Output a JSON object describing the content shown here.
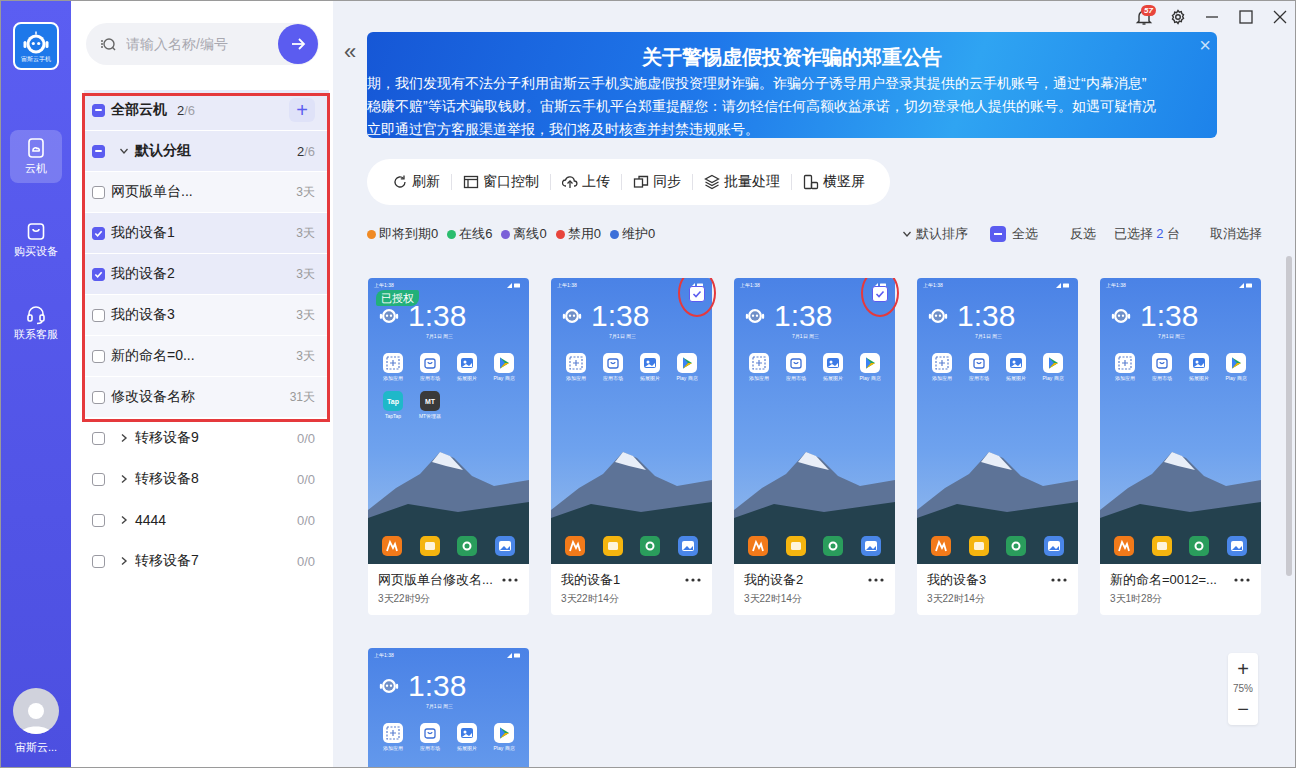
{
  "window": {
    "notification_count": "57"
  },
  "app": {
    "logo_text": "宙斯云手机"
  },
  "nav": [
    {
      "label": "云机",
      "selected": true,
      "kind": "phone"
    },
    {
      "label": "购买设备",
      "selected": false,
      "kind": "bag"
    },
    {
      "label": "联系客服",
      "selected": false,
      "kind": "headset"
    }
  ],
  "user": {
    "name": "宙斯云..."
  },
  "search": {
    "placeholder": "请输入名称/编号"
  },
  "collapse_button": "«",
  "tree": [
    {
      "kind": "all",
      "label": "全部云机",
      "count": "2",
      "total": "/6",
      "checked": false,
      "partial": true,
      "add": "+"
    },
    {
      "kind": "group",
      "label": "默认分组",
      "count": "2",
      "total": "/6",
      "checked": false,
      "partial": true,
      "expanded": true
    },
    {
      "kind": "device",
      "label": "网页版单台...",
      "days": "3天",
      "checked": false
    },
    {
      "kind": "device",
      "label": "我的设备1",
      "days": "3天",
      "checked": true
    },
    {
      "kind": "device",
      "label": "我的设备2",
      "days": "3天",
      "checked": true
    },
    {
      "kind": "device",
      "label": "我的设备3",
      "days": "3天",
      "checked": false
    },
    {
      "kind": "device",
      "label": "新的命名=0...",
      "days": "3天",
      "checked": false
    },
    {
      "kind": "device",
      "label": "修改设备名称",
      "days": "31天",
      "checked": false
    },
    {
      "kind": "group",
      "label": "转移设备9",
      "count": "0",
      "total": "/0",
      "checked": false,
      "partial": false,
      "expanded": false
    },
    {
      "kind": "group",
      "label": "转移设备8",
      "count": "0",
      "total": "/0",
      "checked": false,
      "partial": false,
      "expanded": false
    },
    {
      "kind": "group",
      "label": "4444",
      "count": "0",
      "total": "/0",
      "checked": false,
      "partial": false,
      "expanded": false
    },
    {
      "kind": "group",
      "label": "转移设备7",
      "count": "0",
      "total": "/0",
      "checked": false,
      "partial": false,
      "expanded": false
    }
  ],
  "banner": {
    "title": "关于警惕虚假投资诈骗的郑重公告",
    "lines": [
      "期，我们发现有不法分子利用宙斯云手机实施虚假投资理财诈骗。诈骗分子诱导用户登录其提供的云手机账号，通过“内幕消息”",
      "稳赚不赔”等话术骗取钱财。宙斯云手机平台郑重提醒您：请勿轻信任何高额收益承诺，切勿登录他人提供的账号。如遇可疑情况",
      "立即通过官方客服渠道举报，我们将及时核查并封禁违规账号。"
    ],
    "close": "×"
  },
  "toolbar": [
    {
      "label": "刷新",
      "kind": "refresh"
    },
    {
      "label": "窗口控制",
      "kind": "window"
    },
    {
      "label": "上传",
      "kind": "upload"
    },
    {
      "label": "同步",
      "kind": "sync"
    },
    {
      "label": "批量处理",
      "kind": "layers"
    },
    {
      "label": "横竖屏",
      "kind": "rotate"
    }
  ],
  "legend": [
    {
      "label": "即将到期0",
      "color": "#f08a24"
    },
    {
      "label": "在线6",
      "color": "#2bbd6e"
    },
    {
      "label": "离线0",
      "color": "#7b61d8"
    },
    {
      "label": "禁用0",
      "color": "#e8453c"
    },
    {
      "label": "维护0",
      "color": "#3c6fd9"
    }
  ],
  "sort": {
    "label": "默认排序"
  },
  "select_all": {
    "label": "全选",
    "checked": false,
    "partial": true
  },
  "invert": "反选",
  "selection": {
    "prefix": "已选择 ",
    "count": "2",
    "suffix": " 台"
  },
  "cancel": "取消选择",
  "phone_screen": {
    "status_time": "上午1:38",
    "clock": "1:38",
    "date": "7月1日 周三",
    "apps": [
      {
        "label": "添加应用",
        "kind": "add"
      },
      {
        "label": "应用市场",
        "kind": "store"
      },
      {
        "label": "拓展图片",
        "kind": "gallery"
      },
      {
        "label": "Play 商店",
        "kind": "play"
      }
    ]
  },
  "cards": [
    {
      "name": "网页版单台修改名...",
      "time": "3天22时9分",
      "selected": false,
      "badge": "已授权",
      "extra_apps": [
        {
          "icon_text": "Tap",
          "label": "TapTap",
          "color": "#1fb8c9"
        },
        {
          "icon_text": "MT",
          "label": "MT管理器",
          "color": "#3a3a3a"
        }
      ]
    },
    {
      "name": "我的设备1",
      "time": "3天22时14分",
      "selected": true
    },
    {
      "name": "我的设备2",
      "time": "3天22时14分",
      "selected": true
    },
    {
      "name": "我的设备3",
      "time": "3天22时14分",
      "selected": false
    },
    {
      "name": "新的命名=0012=...",
      "time": "3天1时28分",
      "selected": false
    },
    {
      "selected": false
    }
  ],
  "zoom": {
    "in": "+",
    "level": "75%",
    "out": "−"
  }
}
